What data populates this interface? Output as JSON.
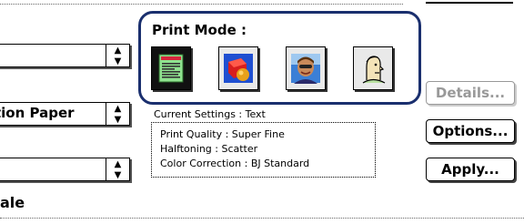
{
  "left_panel": {
    "popup1_value": "",
    "popup2_value": "tion Paper",
    "popup3_value": "",
    "scale_label": "ale"
  },
  "print_mode": {
    "title": "Print Mode :",
    "modes": [
      {
        "icon": "text-document-icon",
        "selected": true
      },
      {
        "icon": "graphics-shapes-icon",
        "selected": false
      },
      {
        "icon": "photo-portrait-icon",
        "selected": false
      },
      {
        "icon": "cartoon-face-icon",
        "selected": false
      }
    ]
  },
  "current_settings": {
    "label": "Current Settings : Text",
    "print_quality": "Print Quality : Super Fine",
    "halftoning": "Halftoning : Scatter",
    "color_correction": "Color Correction : BJ Standard"
  },
  "buttons": {
    "details": "Details...",
    "options": "Options...",
    "apply": "Apply..."
  },
  "colors": {
    "group_border": "#1a2f6e",
    "disabled_text": "#999999"
  }
}
